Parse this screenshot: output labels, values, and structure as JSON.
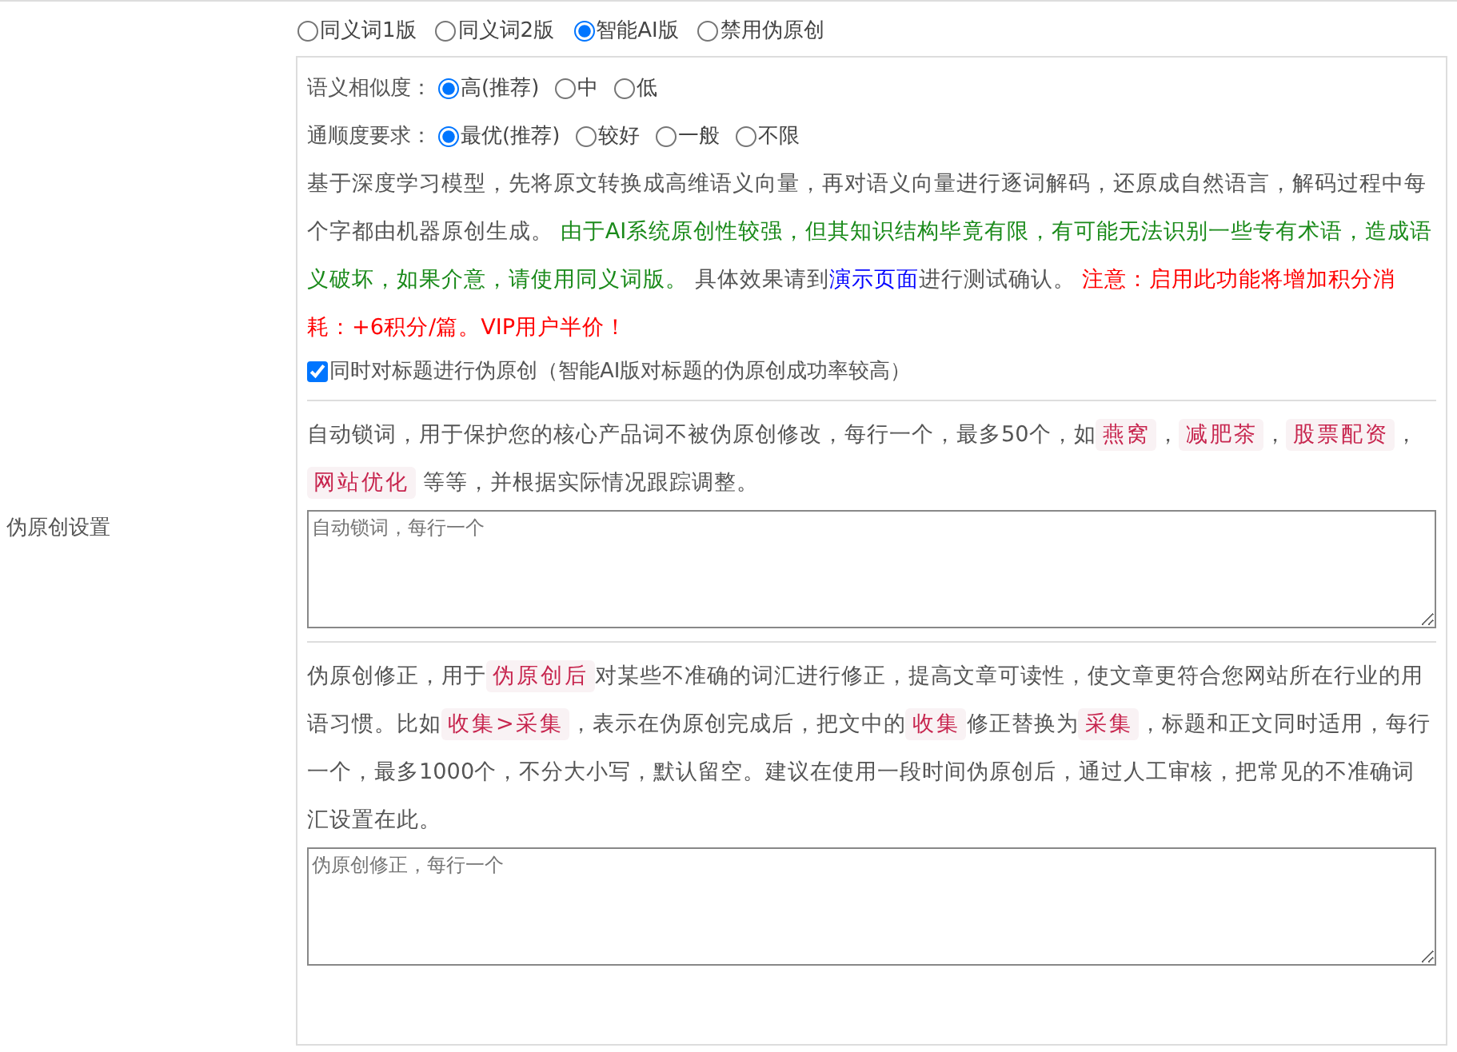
{
  "section_label": "伪原创设置",
  "modes": [
    {
      "label": "同义词1版",
      "selected": false
    },
    {
      "label": "同义词2版",
      "selected": false
    },
    {
      "label": "智能AI版",
      "selected": true
    },
    {
      "label": "禁用伪原创",
      "selected": false
    }
  ],
  "settings": [
    {
      "label": "语义相似度：",
      "options": [
        {
          "label": "高(推荐)",
          "selected": true
        },
        {
          "label": "中",
          "selected": false
        },
        {
          "label": "低",
          "selected": false
        }
      ]
    },
    {
      "label": "通顺度要求：",
      "options": [
        {
          "label": "最优(推荐)",
          "selected": true
        },
        {
          "label": "较好",
          "selected": false
        },
        {
          "label": "一般",
          "selected": false
        },
        {
          "label": "不限",
          "selected": false
        }
      ]
    }
  ],
  "description": [
    {
      "kind": "plain",
      "text": "基于深度学习模型，先将原文转换成高维语义向量，再对语义向量进行逐词解码，还原成自然语言，解码过程中每个字都由机器原创生成。 "
    },
    {
      "kind": "green",
      "text": "由于AI系统原创性较强，但其知识结构毕竟有限，有可能无法识别一些专有术语，造成语义破坏，如果介意，请使用同义词版。"
    },
    {
      "kind": "plain",
      "text": " 具体效果请到"
    },
    {
      "kind": "link",
      "text": "演示页面"
    },
    {
      "kind": "plain",
      "text": "进行测试确认。 "
    },
    {
      "kind": "red",
      "text": "注意：启用此功能将增加积分消耗：+6积分/篇。VIP用户半价！"
    }
  ],
  "title_option": {
    "label": "同时对标题进行伪原创（智能AI版对标题的伪原创成功率较高）",
    "checked": true
  },
  "lock_words": {
    "text": [
      {
        "kind": "plain",
        "text": "自动锁词，用于保护您的核心产品词不被伪原创修改，每行一个，最多50个，如"
      },
      {
        "kind": "tag",
        "text": "燕窝"
      },
      {
        "kind": "plain",
        "text": "，"
      },
      {
        "kind": "tag",
        "text": "减肥茶"
      },
      {
        "kind": "plain",
        "text": "，"
      },
      {
        "kind": "tag",
        "text": "股票配资"
      },
      {
        "kind": "plain",
        "text": "，"
      },
      {
        "kind": "tag",
        "text": "网站优化"
      },
      {
        "kind": "plain",
        "text": " 等等，并根据实际情况跟踪调整。"
      }
    ],
    "placeholder": "自动锁词，每行一个"
  },
  "correction": {
    "text": [
      {
        "kind": "plain",
        "text": "伪原创修正，用于"
      },
      {
        "kind": "tag",
        "text": "伪原创后"
      },
      {
        "kind": "plain",
        "text": "对某些不准确的词汇进行修正，提高文章可读性，使文章更符合您网站所在行业的用语习惯。比如"
      },
      {
        "kind": "tag",
        "text": "收集>采集"
      },
      {
        "kind": "plain",
        "text": "，表示在伪原创完成后，把文中的"
      },
      {
        "kind": "tag",
        "text": "收集"
      },
      {
        "kind": "plain",
        "text": "修正替换为"
      },
      {
        "kind": "tag",
        "text": "采集"
      },
      {
        "kind": "plain",
        "text": "，标题和正文同时适用，每行一个，最多1000个，不分大小写，默认留空。建议在使用一段时间伪原创后，通过人工审核，把常见的不准确词汇设置在此。"
      }
    ],
    "placeholder": "伪原创修正，每行一个"
  }
}
